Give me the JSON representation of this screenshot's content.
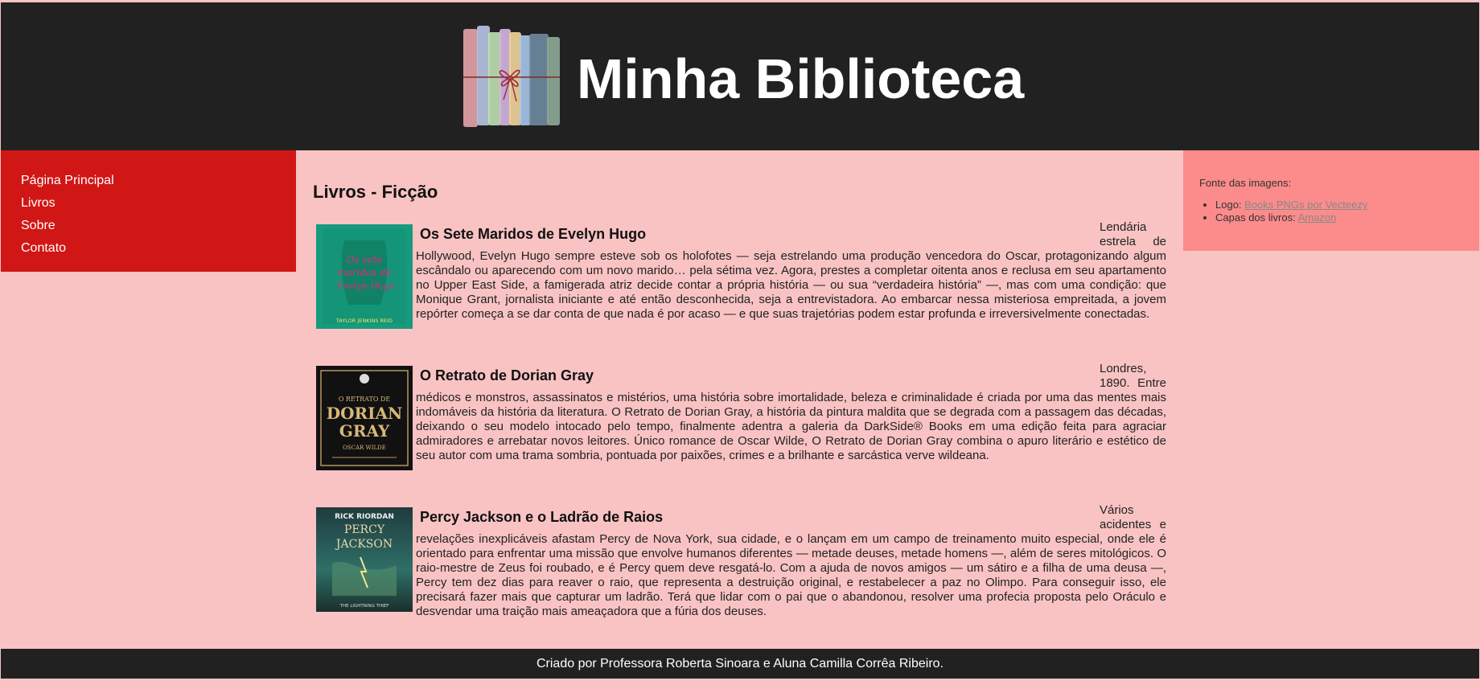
{
  "header": {
    "title": "Minha Biblioteca"
  },
  "nav": {
    "items": [
      "Página Principal",
      "Livros",
      "Sobre",
      "Contato"
    ]
  },
  "main": {
    "page_title": "Livros - Ficção",
    "books": [
      {
        "title": "Os Sete Maridos de Evelyn Hugo",
        "description": "Lendária estrela de Hollywood, Evelyn Hugo sempre esteve sob os holofotes — seja estrelando uma produção vencedora do Oscar, protagonizando algum escândalo ou aparecendo com um novo marido… pela sétima vez. Agora, prestes a completar oitenta anos e reclusa em seu apartamento no Upper East Side, a famigerada atriz decide contar a própria história — ou sua “verdadeira história” —, mas com uma condição: que Monique Grant, jornalista iniciante e até então desconhecida, seja a entrevistadora. Ao embarcar nessa misteriosa empreitada, a jovem repórter começa a se dar conta de que nada é por acaso — e que suas trajetórias podem estar profunda e irreversivelmente conectadas.",
        "cover_text": {
          "line1": "Os sete",
          "line2": "maridos de",
          "line3": "Evelyn Hugo",
          "author": "TAYLOR JENKINS REID"
        }
      },
      {
        "title": "O Retrato de Dorian Gray",
        "description": "Londres, 1890. Entre médicos e monstros, assassinatos e mistérios, uma história sobre imortalidade, beleza e criminalidade é criada por uma das mentes mais indomáveis da história da literatura. O Retrato de Dorian Gray, a história da pintura maldita que se degrada com a passagem das décadas, deixando o seu modelo intocado pelo tempo, finalmente adentra a galeria da DarkSide® Books em uma edição feita para agraciar admiradores e arrebatar novos leitores. Único romance de Oscar Wilde, O Retrato de Dorian Gray combina o apuro literário e estético de seu autor com uma trama sombria, pontuada por paixões, crimes e a brilhante e sarcástica verve wildeana.",
        "cover_text": {
          "line1": "O RETRATO DE",
          "line2": "DORIAN",
          "line3": "GRAY",
          "author": "OSCAR WILDE"
        }
      },
      {
        "title": "Percy Jackson e o Ladrão de Raios",
        "description": "Vários acidentes e revelações inexplicáveis afastam Percy de Nova York, sua cidade, e o lançam em um campo de treinamento muito especial, onde ele é orientado para enfrentar uma missão que envolve humanos diferentes — metade deuses, metade homens —, além de seres mitológicos. O raio-mestre de Zeus foi roubado, e é Percy quem deve resgatá-lo. Com a ajuda de novos amigos — um sátiro e a filha de uma deusa —, Percy tem dez dias para reaver o raio, que representa a destruição original, e restabelecer a paz no Olimpo. Para conseguir isso, ele precisará fazer mais que capturar um ladrão. Terá que lidar com o pai que o abandonou, resolver uma profecia proposta pelo Oráculo e desvendar uma traição mais ameaçadora que a fúria dos deuses.",
        "cover_text": {
          "line1": "RICK RIORDAN",
          "line2": "PERCY",
          "line3": "JACKSON",
          "author": "THE LIGHTNING THIEF"
        }
      }
    ]
  },
  "aside": {
    "title": "Fonte das imagens:",
    "items": [
      {
        "label": "Logo: ",
        "link": "Books PNGs por Vecteezy"
      },
      {
        "label": "Capas dos livros: ",
        "link": "Amazon"
      }
    ]
  },
  "footer": {
    "text": "Criado por Professora Roberta Sinoara e Aluna Camilla Corrêa Ribeiro."
  },
  "colors": {
    "page_bg": "#f9c3c3",
    "header_bg": "#212121",
    "nav_bg": "#d01716",
    "aside_bg": "#fc8b8b"
  }
}
